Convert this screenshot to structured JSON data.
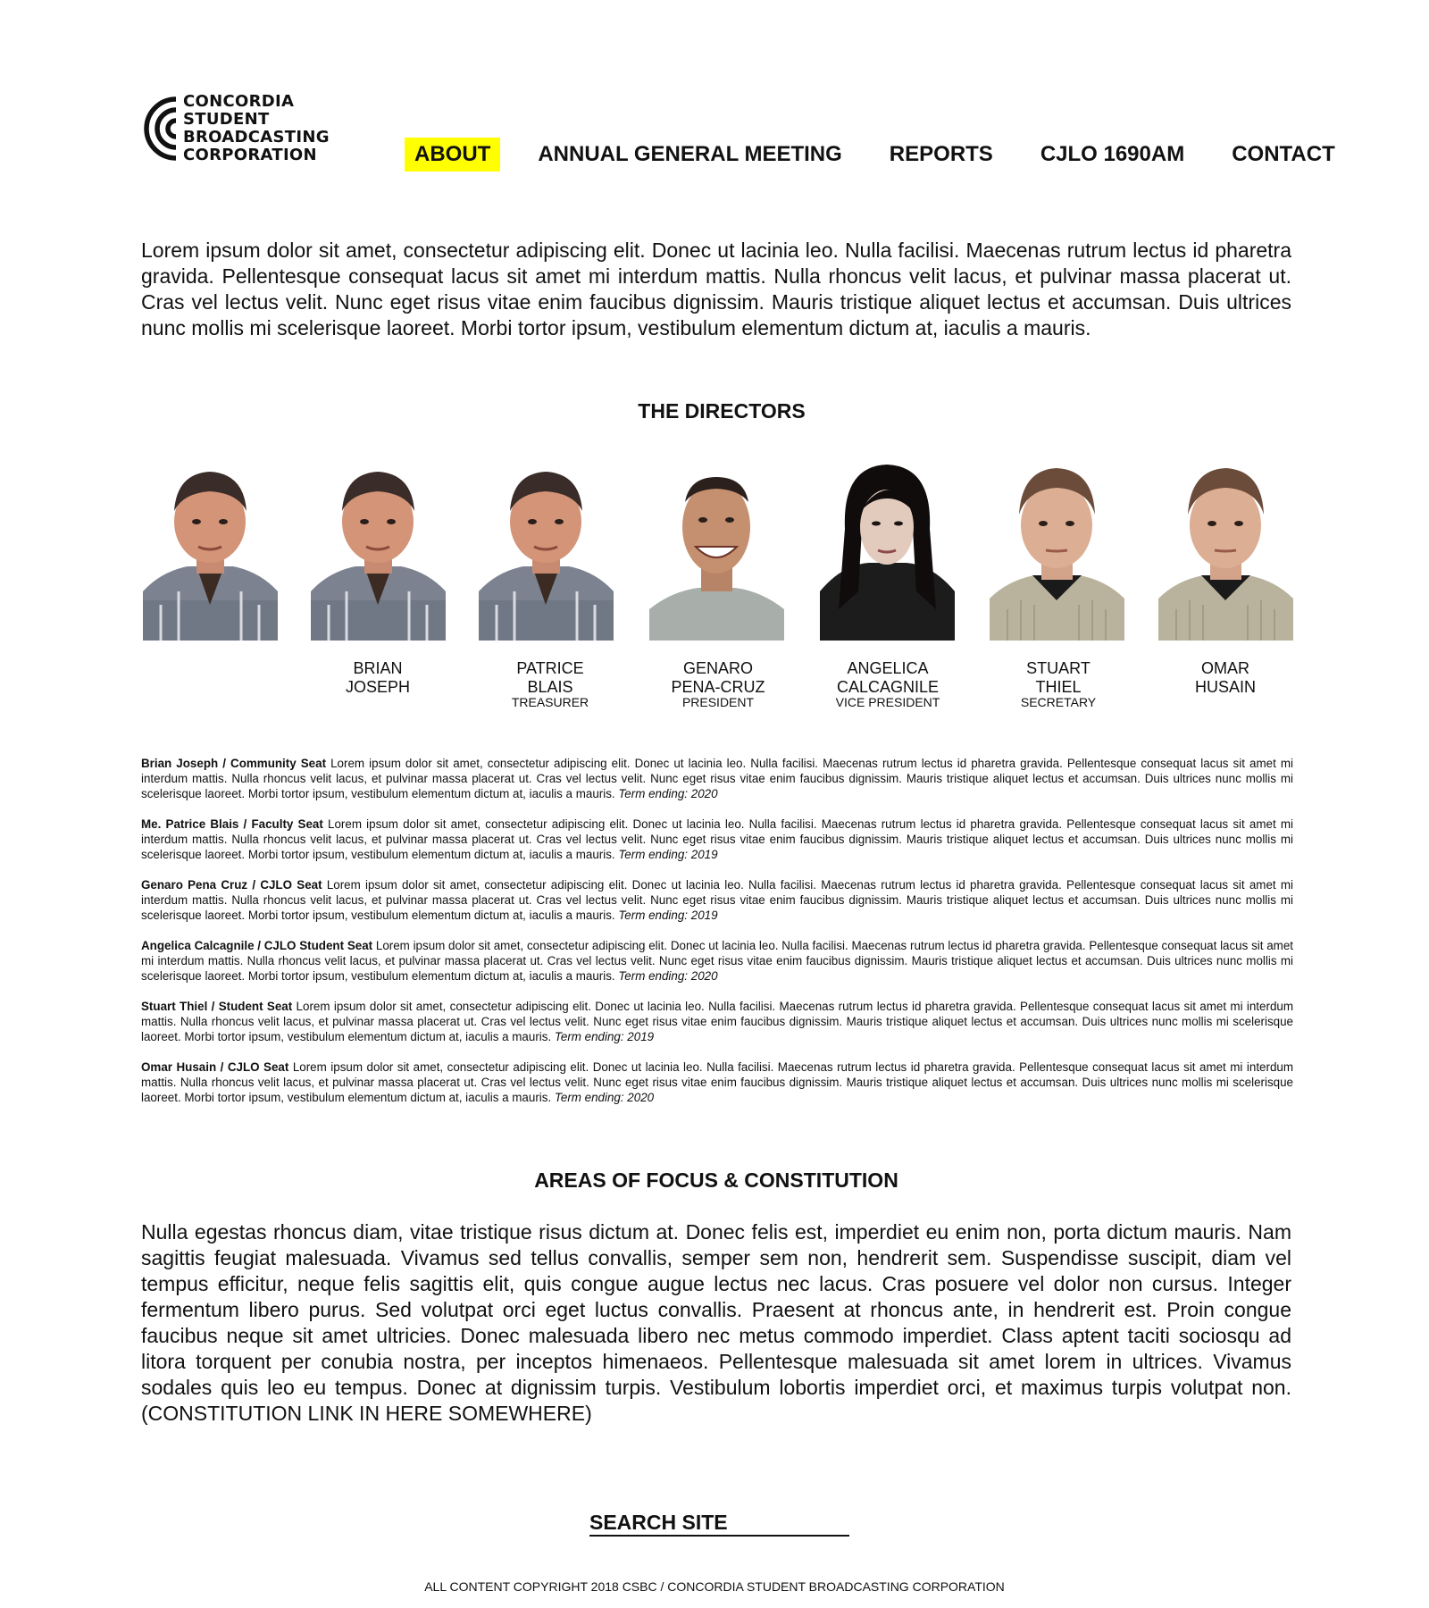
{
  "logo": {
    "lines": [
      "CONCORDIA",
      "STUDENT",
      "BROADCASTING",
      "CORPORATION"
    ],
    "icon": "csbc-concentric-c-icon"
  },
  "nav": {
    "items": [
      {
        "label": "ABOUT",
        "active": true
      },
      {
        "label": "ANNUAL GENERAL MEETING",
        "active": false
      },
      {
        "label": "REPORTS",
        "active": false
      },
      {
        "label": "CJLO 1690AM",
        "active": false
      },
      {
        "label": "CONTACT",
        "active": false
      }
    ],
    "active_color": "#ffff00"
  },
  "intro": "Lorem ipsum dolor sit amet, consectetur adipiscing elit. Donec ut lacinia leo. Nulla facilisi. Maecenas rutrum lectus id pharetra gravida. Pellentesque consequat lacus sit amet mi interdum mattis. Nulla rhoncus velit lacus, et pulvinar massa placerat ut. Cras vel lectus velit. Nunc eget risus vitae enim faucibus dignissim. Mauris tristique aliquet lectus et accumsan. Duis ultrices nunc mollis mi scelerisque laoreet. Morbi tortor ipsum, vestibulum elementum dictum at, iaculis a mauris.",
  "directors": {
    "title": "THE DIRECTORS",
    "people": [
      {
        "first": "",
        "last": "",
        "role": ""
      },
      {
        "first": "BRIAN",
        "last": "JOSEPH",
        "role": ""
      },
      {
        "first": "PATRICE",
        "last": "BLAIS",
        "role": "TREASURER"
      },
      {
        "first": "GENARO",
        "last": "PENA-CRUZ",
        "role": "PRESIDENT"
      },
      {
        "first": "ANGELICA",
        "last": "CALCAGNILE",
        "role": "VICE PRESIDENT"
      },
      {
        "first": "STUART",
        "last": "THIEL",
        "role": "SECRETARY"
      },
      {
        "first": "OMAR",
        "last": "HUSAIN",
        "role": ""
      }
    ]
  },
  "bios": [
    {
      "name": "Brian Joseph / Community Seat",
      "text": "Lorem ipsum dolor sit amet, consectetur adipiscing elit. Donec ut lacinia leo. Nulla facilisi. Maecenas rutrum lectus id pharetra gravida. Pellentesque consequat lacus sit amet mi interdum mattis. Nulla rhoncus velit lacus, et pulvinar massa placerat ut. Cras vel lectus velit. Nunc eget risus vitae enim faucibus dignissim. Mauris tristique aliquet lectus et accumsan. Duis ultrices nunc mollis mi scelerisque laoreet. Morbi tortor ipsum, vestibulum elementum dictum at, iaculis a mauris.",
      "term": "Term ending: 2020"
    },
    {
      "name": "Me. Patrice Blais / Faculty Seat",
      "text": "Lorem ipsum dolor sit amet, consectetur adipiscing elit. Donec ut lacinia leo. Nulla facilisi. Maecenas rutrum lectus id pharetra gravida. Pellentesque consequat lacus sit amet mi interdum mattis. Nulla rhoncus velit lacus, et pulvinar massa placerat ut. Cras vel lectus velit. Nunc eget risus vitae enim faucibus dignissim. Mauris tristique aliquet lectus et accumsan. Duis ultrices nunc mollis mi scelerisque laoreet. Morbi tortor ipsum, vestibulum elementum dictum at, iaculis a mauris.",
      "term": "Term ending: 2019"
    },
    {
      "name": "Genaro Pena Cruz / CJLO Seat",
      "text": "Lorem ipsum dolor sit amet, consectetur adipiscing elit. Donec ut lacinia leo. Nulla facilisi. Maecenas rutrum lectus id pharetra gravida. Pellentesque consequat lacus sit amet mi interdum mattis. Nulla rhoncus velit lacus, et pulvinar massa placerat ut. Cras vel lectus velit. Nunc eget risus vitae enim faucibus dignissim. Mauris tristique aliquet lectus et accumsan. Duis ultrices nunc mollis mi scelerisque laoreet. Morbi tortor ipsum, vestibulum elementum dictum at, iaculis a mauris.",
      "term": "Term ending: 2019"
    },
    {
      "name": "Angelica Calcagnile / CJLO Student Seat",
      "text": "Lorem ipsum dolor sit amet, consectetur adipiscing elit. Donec ut lacinia leo. Nulla facilisi. Maecenas rutrum lectus id pharetra gravida. Pellentesque consequat lacus sit amet mi interdum mattis. Nulla rhoncus velit lacus, et pulvinar massa placerat ut. Cras vel lectus velit. Nunc eget risus vitae enim faucibus dignissim. Mauris tristique aliquet lectus et accumsan. Duis ultrices nunc mollis mi scelerisque laoreet. Morbi tortor ipsum, vestibulum elementum dictum at, iaculis a mauris.",
      "term": "Term ending: 2020"
    },
    {
      "name": "Stuart Thiel / Student Seat",
      "text": "Lorem ipsum dolor sit amet, consectetur adipiscing elit. Donec ut lacinia leo. Nulla facilisi. Maecenas rutrum lectus id pharetra gravida. Pellentesque consequat lacus sit amet mi interdum mattis. Nulla rhoncus velit lacus, et pulvinar massa placerat ut. Cras vel lectus velit. Nunc eget risus vitae enim faucibus dignissim. Mauris tristique aliquet lectus et accumsan. Duis ultrices nunc mollis mi scelerisque laoreet. Morbi tortor ipsum, vestibulum elementum dictum at, iaculis a mauris.",
      "term": "Term ending: 2019"
    },
    {
      "name": "Omar Husain / CJLO Seat",
      "text": "Lorem ipsum dolor sit amet, consectetur adipiscing elit. Donec ut lacinia leo. Nulla facilisi. Maecenas rutrum lectus id pharetra gravida. Pellentesque consequat lacus sit amet mi interdum mattis. Nulla rhoncus velit lacus, et pulvinar massa placerat ut. Cras vel lectus velit. Nunc eget risus vitae enim faucibus dignissim. Mauris tristique aliquet lectus et accumsan. Duis ultrices nunc mollis mi scelerisque laoreet. Morbi tortor ipsum, vestibulum elementum dictum at, iaculis a mauris.",
      "term": "Term ending: 2020"
    }
  ],
  "focus": {
    "title": "AREAS OF FOCUS & CONSTITUTION",
    "text": "Nulla egestas rhoncus diam, vitae tristique risus dictum at. Donec felis est, imperdiet eu enim non, porta dictum mauris. Nam sagittis feugiat malesuada. Vivamus sed tellus convallis, semper sem non, hendrerit sem. Suspendisse suscipit, diam vel tempus efficitur, neque felis sagittis elit, quis congue augue lectus nec lacus. Cras posuere vel dolor non cursus. Integer fermentum libero purus. Sed volutpat orci eget luctus convallis. Praesent at rhoncus ante, in hendrerit est. Proin congue faucibus neque sit amet ultricies. Donec malesuada libero nec metus commodo imperdiet. Class aptent taciti sociosqu ad litora torquent per conubia nostra, per inceptos himenaeos. Pellentesque malesuada sit amet lorem in ultrices. Vivamus sodales quis leo eu tempus. Donec at dignissim turpis. Vestibulum lobortis imperdiet orci, et maximus turpis volutpat non. (CONSTITUTION LINK IN HERE SOMEWHERE)"
  },
  "footer": {
    "search_label": "SEARCH SITE",
    "copyright": "ALL CONTENT COPYRIGHT 2018 CSBC / CONCORDIA STUDENT BROADCASTING CORPORATION"
  }
}
